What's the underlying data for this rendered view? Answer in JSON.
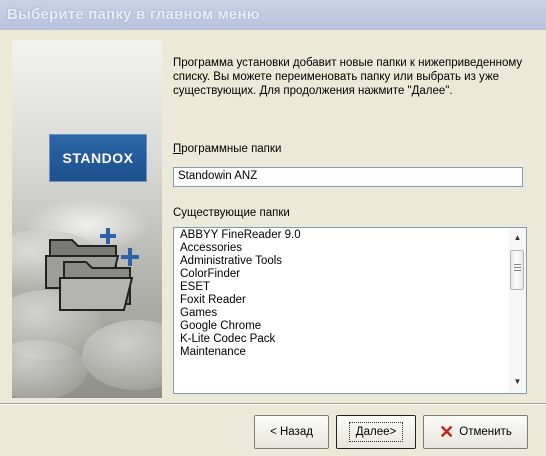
{
  "window": {
    "title": "Выберите папку в главном меню"
  },
  "sidebar": {
    "logo_text": "STANDOX"
  },
  "content": {
    "description": "Программа установки добавит новые папки к нижеприведенному списку. Вы можете переименовать папку или выбрать из уже существующих. Для продолжения нажмите \"Далее\".",
    "program_folder": {
      "label_first": "П",
      "label_rest": "рограммные папки",
      "value": "Standowin ANZ"
    },
    "existing_folders": {
      "label": "Существующие папки",
      "items": [
        "ABBYY FineReader 9.0",
        "Accessories",
        "Administrative Tools",
        "ColorFinder",
        "ESET",
        "Foxit Reader",
        "Games",
        "Google Chrome",
        "K-Lite Codec Pack",
        "Maintenance"
      ]
    }
  },
  "buttons": {
    "back": "< Назад",
    "next": "Далее>",
    "cancel": "Отменить"
  },
  "icons": {
    "scroll_up": "up-arrow-icon",
    "scroll_down": "down-arrow-icon",
    "cancel": "red-x-icon",
    "folders": "add-folders-icon"
  },
  "colors": {
    "logo_blue": "#1c4f8c",
    "cancel_x": "#c0211a",
    "window_bg": "#ece9d8"
  }
}
